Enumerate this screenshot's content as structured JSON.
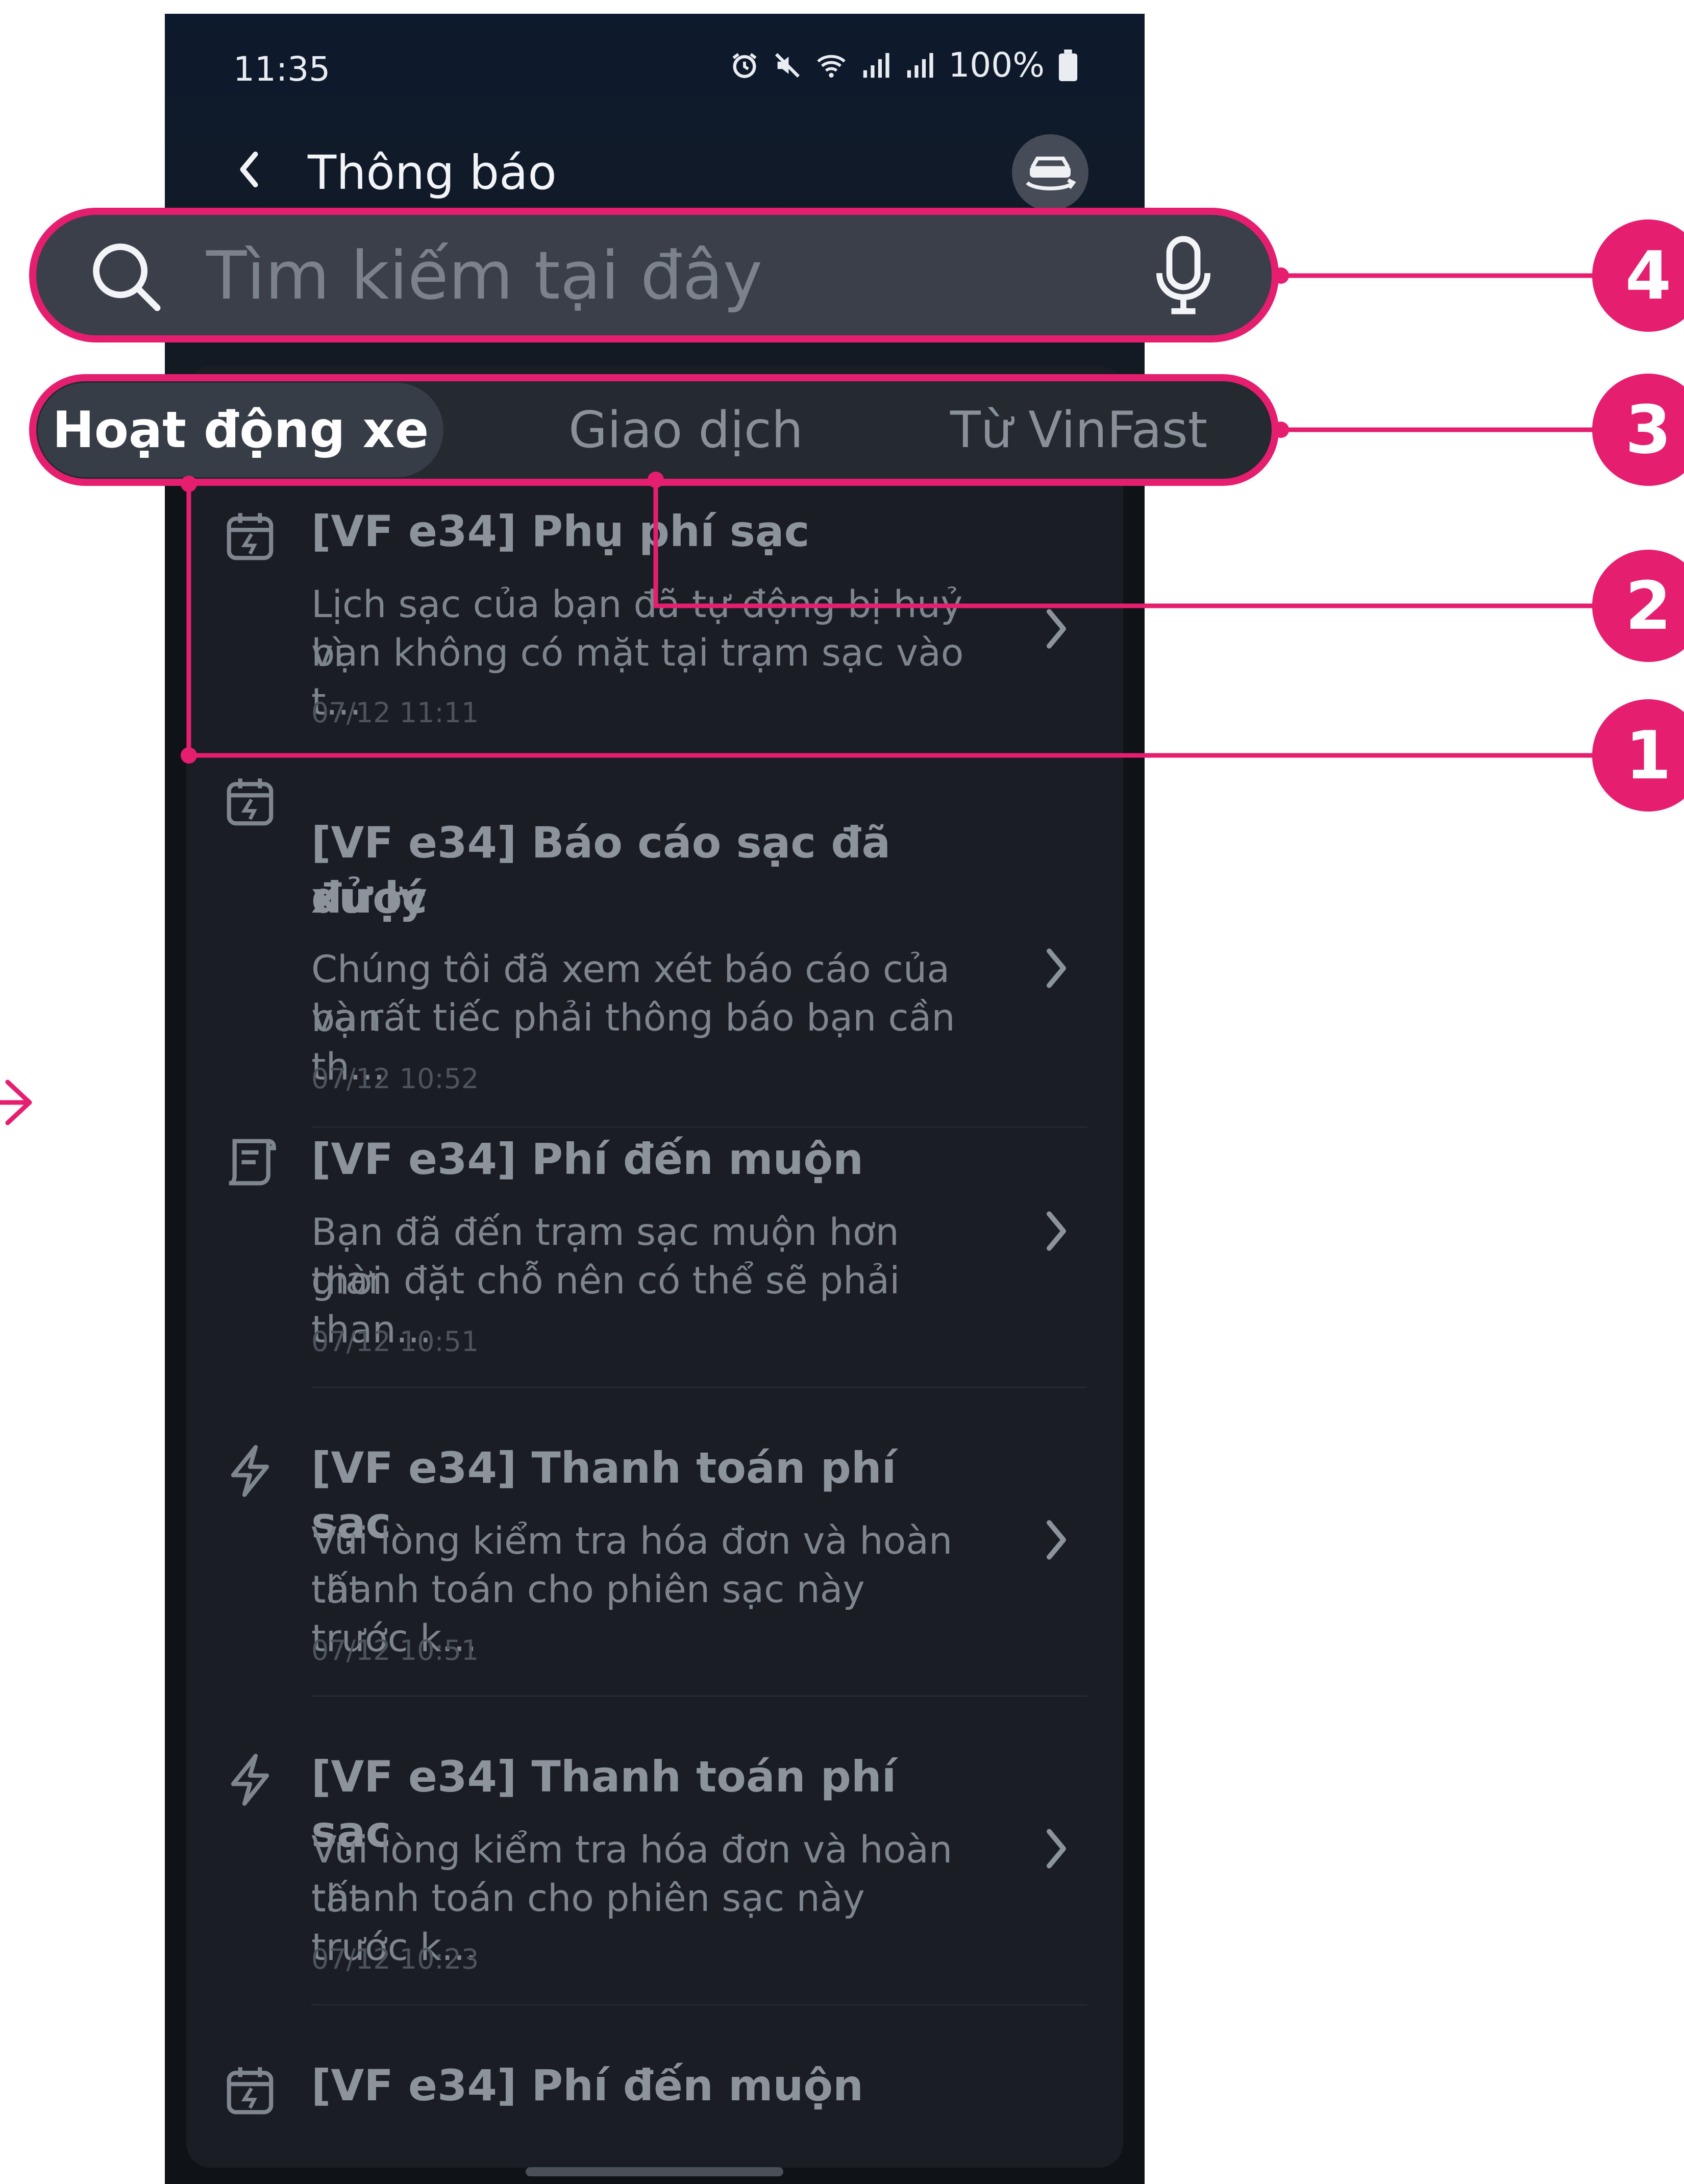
{
  "status_bar": {
    "time": "11:35",
    "battery": "100%"
  },
  "header": {
    "title": "Thông báo",
    "back_icon": "chevron-left-icon",
    "action_icon": "car-sync-icon"
  },
  "search": {
    "placeholder": "Tìm kiếm tại đây",
    "search_icon": "search-icon",
    "mic_icon": "microphone-icon"
  },
  "tabs": [
    {
      "label": "Hoạt động xe",
      "active": true
    },
    {
      "label": "Giao dịch",
      "active": false
    },
    {
      "label": "Từ VinFast",
      "active": false
    }
  ],
  "notifications": [
    {
      "icon": "calendar-charge-icon",
      "title": "[VF e34] Phụ phí sạc",
      "body_line1": "Lịch sạc của bạn đã tự động bị huỷ vì",
      "body_line2": "bạn không có mặt tại trạm sạc vào t...",
      "time": "07/12 11:11"
    },
    {
      "icon": "calendar-charge-icon",
      "title_line1": "[VF e34] Báo cáo sạc đã được",
      "title_line2": "xử lý",
      "body_line1": "Chúng tôi đã xem xét báo cáo của bạn",
      "body_line2": "và rất tiếc phải thông báo bạn cần th...",
      "time": "07/12 10:52"
    },
    {
      "icon": "receipt-icon",
      "title": "[VF e34] Phí đến muộn",
      "body_line1": "Bạn đã đến trạm sạc muộn hơn thời",
      "body_line2": "gian đặt chỗ nên có thể sẽ phải than...",
      "time": "07/12 10:51"
    },
    {
      "icon": "lightning-icon",
      "title": "[VF e34] Thanh toán phí sạc",
      "body_line1": "Vui lòng kiểm tra hóa đơn và hoàn tất",
      "body_line2": "thanh toán cho phiên sạc này trước k...",
      "time": "07/12 10:51"
    },
    {
      "icon": "lightning-icon",
      "title": "[VF e34] Thanh toán phí sạc",
      "body_line1": "Vui lòng kiểm tra hóa đơn và hoàn tất",
      "body_line2": "thanh toán cho phiên sạc này trước k...",
      "time": "07/12 10:23"
    },
    {
      "icon": "calendar-charge-icon",
      "title": "[VF e34] Phí đến muộn"
    }
  ],
  "callouts": [
    "4",
    "3",
    "2",
    "1"
  ],
  "colors": {
    "accent": "#e51e70",
    "background": "#0f1318",
    "card": "#1a1e24"
  }
}
